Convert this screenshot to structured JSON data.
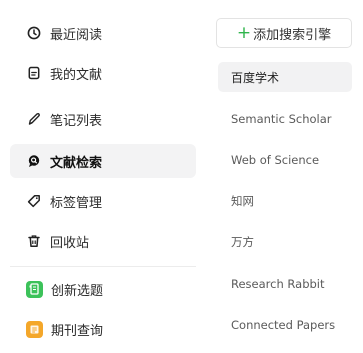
{
  "sidebar": {
    "items": [
      {
        "label": "最近阅读",
        "icon": "clock-icon"
      },
      {
        "label": "我的文献",
        "icon": "document-icon"
      },
      {
        "label": "笔记列表",
        "icon": "pen-icon"
      },
      {
        "label": "文献检索",
        "icon": "search-bubble-icon",
        "active": true
      },
      {
        "label": "标签管理",
        "icon": "tag-icon"
      },
      {
        "label": "回收站",
        "icon": "trash-icon"
      }
    ],
    "apps": [
      {
        "label": "创新选题",
        "icon": "innovation-topic-icon",
        "color": "#3cc25a"
      },
      {
        "label": "期刊查询",
        "icon": "journal-query-icon",
        "color": "#f4a72a"
      }
    ]
  },
  "search_engines": {
    "add_label": "添加搜索引擎",
    "items": [
      {
        "label": "百度学术",
        "active": true
      },
      {
        "label": "Semantic Scholar"
      },
      {
        "label": "Web of Science"
      },
      {
        "label": "知网"
      },
      {
        "label": "万方"
      },
      {
        "label": "Research Rabbit"
      },
      {
        "label": "Connected Papers"
      }
    ]
  },
  "colors": {
    "accent_green": "#2fb54c",
    "active_bg": "#f3f3f4"
  }
}
